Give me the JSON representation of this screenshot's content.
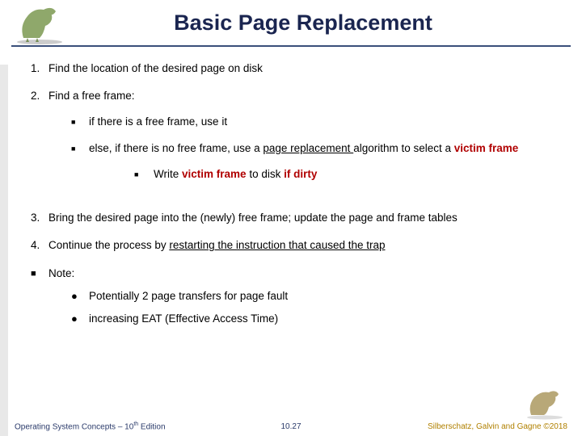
{
  "title": "Basic Page Replacement",
  "steps": {
    "s1": {
      "num": "1.",
      "text": "Find the location of the desired page on disk"
    },
    "s2": {
      "num": "2.",
      "text": "Find a free frame:",
      "a": "if there is a free frame, use it",
      "b_pre": "else, if there is no free frame, use a ",
      "b_page_repl": "page replacement ",
      "b_mid": "algorithm to select a ",
      "b_victim": "victim frame",
      "c_pre": "Write ",
      "c_victim": "victim frame ",
      "c_mid": "to disk ",
      "c_dirty": "if dirty"
    },
    "s3": {
      "num": "3.",
      "text": "Bring  the desired page into the (newly) free frame; update the page and frame tables"
    },
    "s4": {
      "num": "4.",
      "pre": "Continue the process by ",
      "under": "restarting the instruction that caused the trap"
    }
  },
  "note": {
    "label": "Note:",
    "a": "Potentially 2 page transfers for page fault",
    "b": "increasing EAT (Effective Access Time)"
  },
  "footer": {
    "left_pre": "Operating System Concepts – 10",
    "left_sup": "th",
    "left_post": " Edition",
    "mid": "10.27",
    "right": "Silberschatz, Galvin and Gagne ©2018"
  }
}
